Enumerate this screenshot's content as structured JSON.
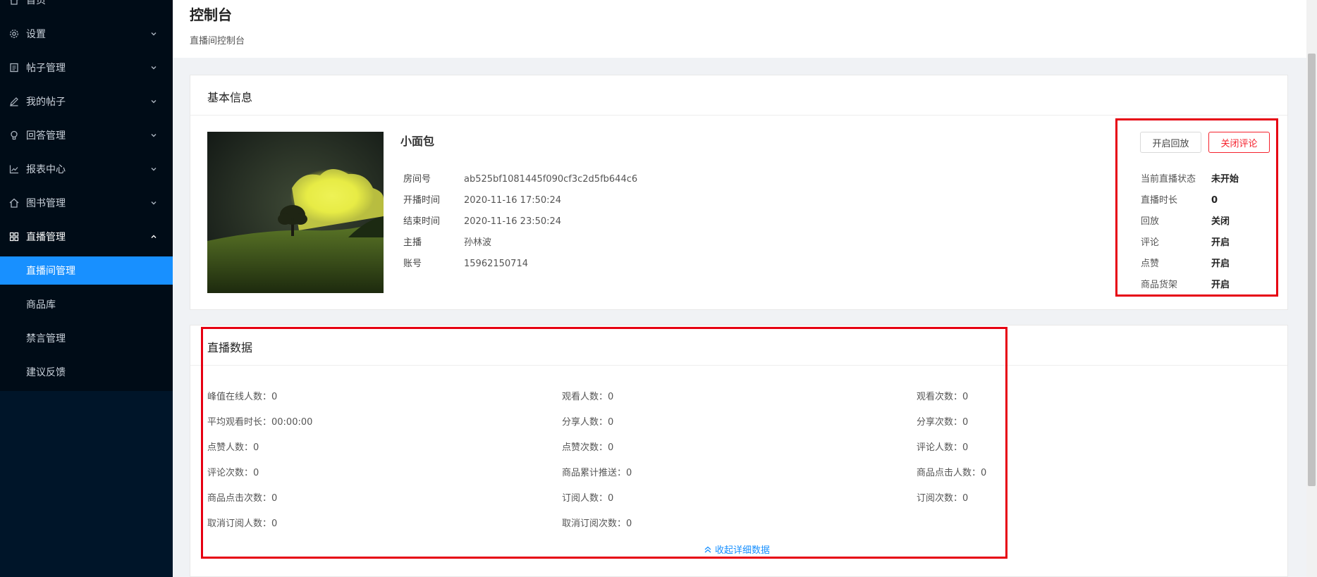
{
  "sidebar": {
    "items": [
      {
        "label": "首页",
        "icon": "home-icon"
      },
      {
        "label": "设置",
        "icon": "gear-icon"
      },
      {
        "label": "帖子管理",
        "icon": "document-icon"
      },
      {
        "label": "我的帖子",
        "icon": "edit-icon"
      },
      {
        "label": "回答管理",
        "icon": "bulb-icon"
      },
      {
        "label": "报表中心",
        "icon": "line-chart-icon"
      },
      {
        "label": "图书管理",
        "icon": "home-icon"
      },
      {
        "label": "直播管理",
        "icon": "appstore-icon"
      }
    ],
    "sub_items": [
      {
        "label": "直播间管理",
        "active": true
      },
      {
        "label": "商品库",
        "active": false
      },
      {
        "label": "禁言管理",
        "active": false
      },
      {
        "label": "建议反馈",
        "active": false
      }
    ]
  },
  "header": {
    "title": "控制台",
    "breadcrumb": "直播间控制台"
  },
  "basic_info": {
    "title": "基本信息",
    "room_name": "小面包",
    "fields": [
      {
        "label": "房间号",
        "value": "ab525bf1081445f090cf3c2d5fb644c6"
      },
      {
        "label": "开播时间",
        "value": "2020-11-16 17:50:24"
      },
      {
        "label": "结束时间",
        "value": "2020-11-16 23:50:24"
      },
      {
        "label": "主播",
        "value": "孙林波"
      },
      {
        "label": "账号",
        "value": "15962150714"
      }
    ],
    "buttons": {
      "replay_label": "开启回放",
      "close_comment_label": "关闭评论"
    },
    "status": [
      {
        "label": "当前直播状态",
        "value": "未开始"
      },
      {
        "label": "直播时长",
        "value": "0"
      },
      {
        "label": "回放",
        "value": "关闭"
      },
      {
        "label": "评论",
        "value": "开启"
      },
      {
        "label": "点赞",
        "value": "开启"
      },
      {
        "label": "商品货架",
        "value": "开启"
      }
    ]
  },
  "live_data": {
    "title": "直播数据",
    "columns": [
      [
        "峰值在线人数：0",
        "平均观看时长：00:00:00",
        "点赞人数：0",
        "评论次数：0",
        "商品点击次数：0",
        "取消订阅人数：0"
      ],
      [
        "观看人数：0",
        "分享人数：0",
        "点赞次数：0",
        "商品累计推送：0",
        "订阅人数：0",
        "取消订阅次数：0"
      ],
      [
        "观看次数：0",
        "分享次数：0",
        "评论人数：0",
        "商品点击人数：0",
        "订阅次数：0"
      ]
    ],
    "collapse_label": "收起详细数据"
  },
  "colors": {
    "sidebar_bg": "#001529",
    "accent": "#1890ff",
    "danger": "#f5222d",
    "highlight": "#e60012"
  }
}
